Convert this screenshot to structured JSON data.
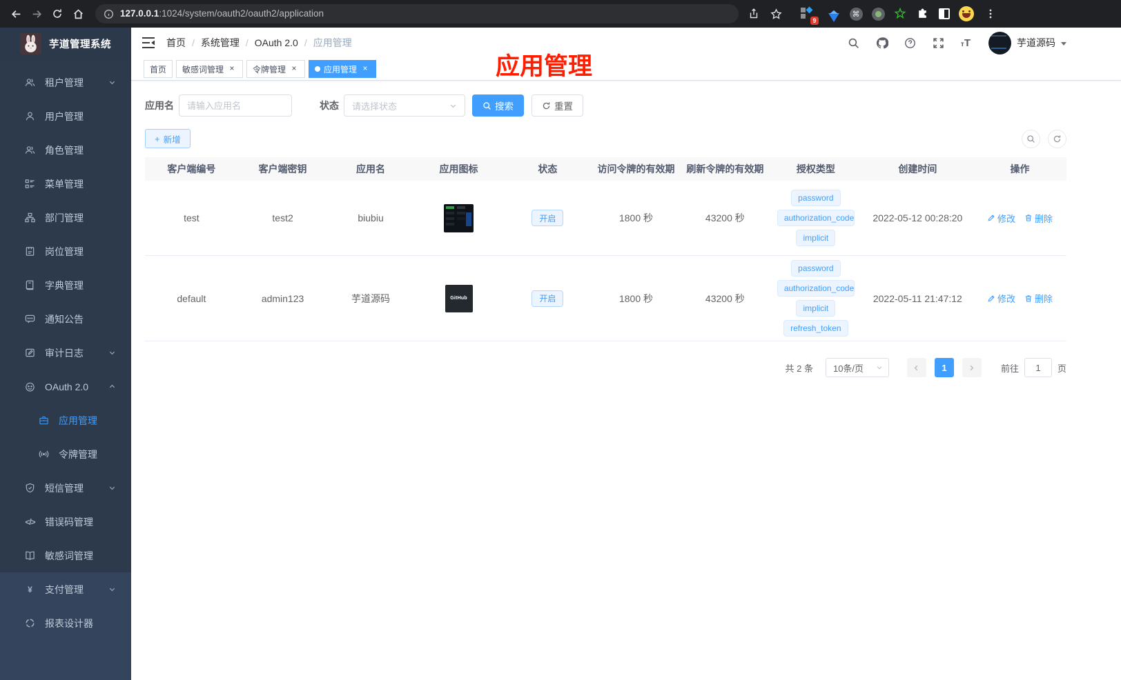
{
  "annotation": {
    "title": "应用管理",
    "color": "#ff1e00"
  },
  "browser": {
    "url_host": "127.0.0.1",
    "url_rest": ":1024/system/oauth2/oauth2/application",
    "extension_badge": "9"
  },
  "sidebar": {
    "app_title": "芋道管理系统",
    "items": [
      {
        "label": "租户管理"
      },
      {
        "label": "用户管理"
      },
      {
        "label": "角色管理"
      },
      {
        "label": "菜单管理"
      },
      {
        "label": "部门管理"
      },
      {
        "label": "岗位管理"
      },
      {
        "label": "字典管理"
      },
      {
        "label": "通知公告"
      },
      {
        "label": "审计日志"
      },
      {
        "label": "OAuth 2.0"
      },
      {
        "label": "应用管理"
      },
      {
        "label": "令牌管理"
      },
      {
        "label": "短信管理"
      },
      {
        "label": "错误码管理"
      },
      {
        "label": "敏感词管理"
      },
      {
        "label": "支付管理"
      },
      {
        "label": "报表设计器"
      }
    ]
  },
  "header": {
    "breadcrumb": [
      "首页",
      "系统管理",
      "OAuth 2.0",
      "应用管理"
    ],
    "user_name": "芋道源码"
  },
  "tabs": [
    {
      "label": "首页"
    },
    {
      "label": "敏感词管理"
    },
    {
      "label": "令牌管理"
    },
    {
      "label": "应用管理"
    }
  ],
  "filters": {
    "name_label": "应用名",
    "name_placeholder": "请输入应用名",
    "status_label": "状态",
    "status_placeholder": "请选择状态",
    "search_label": "搜索",
    "reset_label": "重置"
  },
  "toolbar": {
    "add_label": "新增"
  },
  "table": {
    "columns": [
      "客户端编号",
      "客户端密钥",
      "应用名",
      "应用图标",
      "状态",
      "访问令牌的有效期",
      "刷新令牌的有效期",
      "授权类型",
      "创建时间",
      "操作"
    ],
    "edit_label": "修改",
    "delete_label": "删除",
    "rows": [
      {
        "client_id": "test",
        "secret": "test2",
        "name": "biubiu",
        "status": "开启",
        "access_ttl": "1800 秒",
        "refresh_ttl": "43200 秒",
        "grants": [
          "password",
          "authorization_code",
          "implicit"
        ],
        "created": "2022-05-12 00:28:20"
      },
      {
        "client_id": "default",
        "secret": "admin123",
        "name": "芋道源码",
        "icon_text": "GitHub",
        "status": "开启",
        "access_ttl": "1800 秒",
        "refresh_ttl": "43200 秒",
        "grants": [
          "password",
          "authorization_code",
          "implicit",
          "refresh_token"
        ],
        "created": "2022-05-11 21:47:12"
      }
    ]
  },
  "pagination": {
    "total": "共 2 条",
    "page_size": "10条/页",
    "current": "1",
    "goto_label": "前往",
    "goto_value": "1",
    "page_unit": "页"
  }
}
